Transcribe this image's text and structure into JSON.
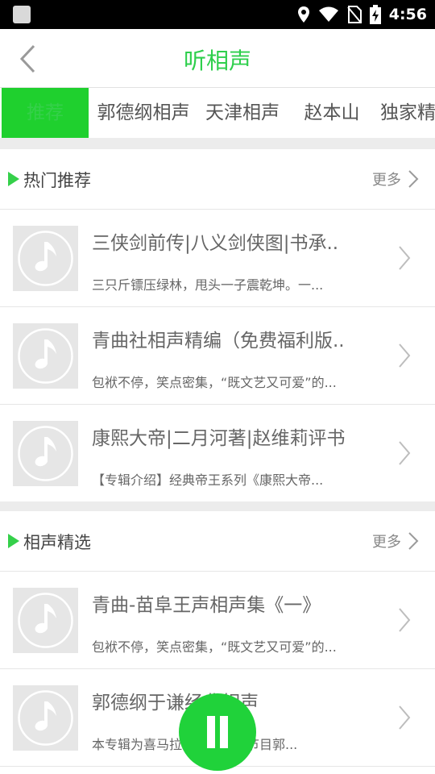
{
  "status_bar": {
    "time": "4:56"
  },
  "header": {
    "title": "听相声"
  },
  "tabs": [
    {
      "label": "推荐",
      "active": true
    },
    {
      "label": "郭德纲相声",
      "active": false
    },
    {
      "label": "天津相声",
      "active": false
    },
    {
      "label": "赵本山",
      "active": false
    },
    {
      "label": "独家精",
      "active": false
    }
  ],
  "sections": [
    {
      "title": "热门推荐",
      "more_label": "更多",
      "items": [
        {
          "title": "三侠剑前传|八义剑侠图|书承..",
          "desc": "三只斤镖压绿林，甩头一子震乾坤。一..."
        },
        {
          "title": "青曲社相声精编（免费福利版..",
          "desc": "包袱不停，笑点密集，“既文艺又可爱”的..."
        },
        {
          "title": "康熙大帝|二月河著|赵维莉评书",
          "desc": "【专辑介绍】经典帝王系列《康熙大帝..."
        }
      ]
    },
    {
      "title": "相声精选",
      "more_label": "更多",
      "items": [
        {
          "title": "青曲-苗阜王声相声集《一》",
          "desc": "包袱不停，笑点密集，“既文艺又可爱”的..."
        },
        {
          "title": "郭德纲于谦经典相声",
          "desc": "本专辑为喜马拉雅【独家】节目郭..."
        }
      ]
    }
  ],
  "colors": {
    "accent": "#2ecf4c",
    "tab_active_bg": "#1fd02e",
    "fab": "#20d23a"
  },
  "icons": {
    "back": "chevron-left-icon",
    "more": "chevron-right-icon",
    "item_arrow": "chevron-right-icon",
    "thumb": "music-note-icon",
    "fab": "pause-icon"
  }
}
